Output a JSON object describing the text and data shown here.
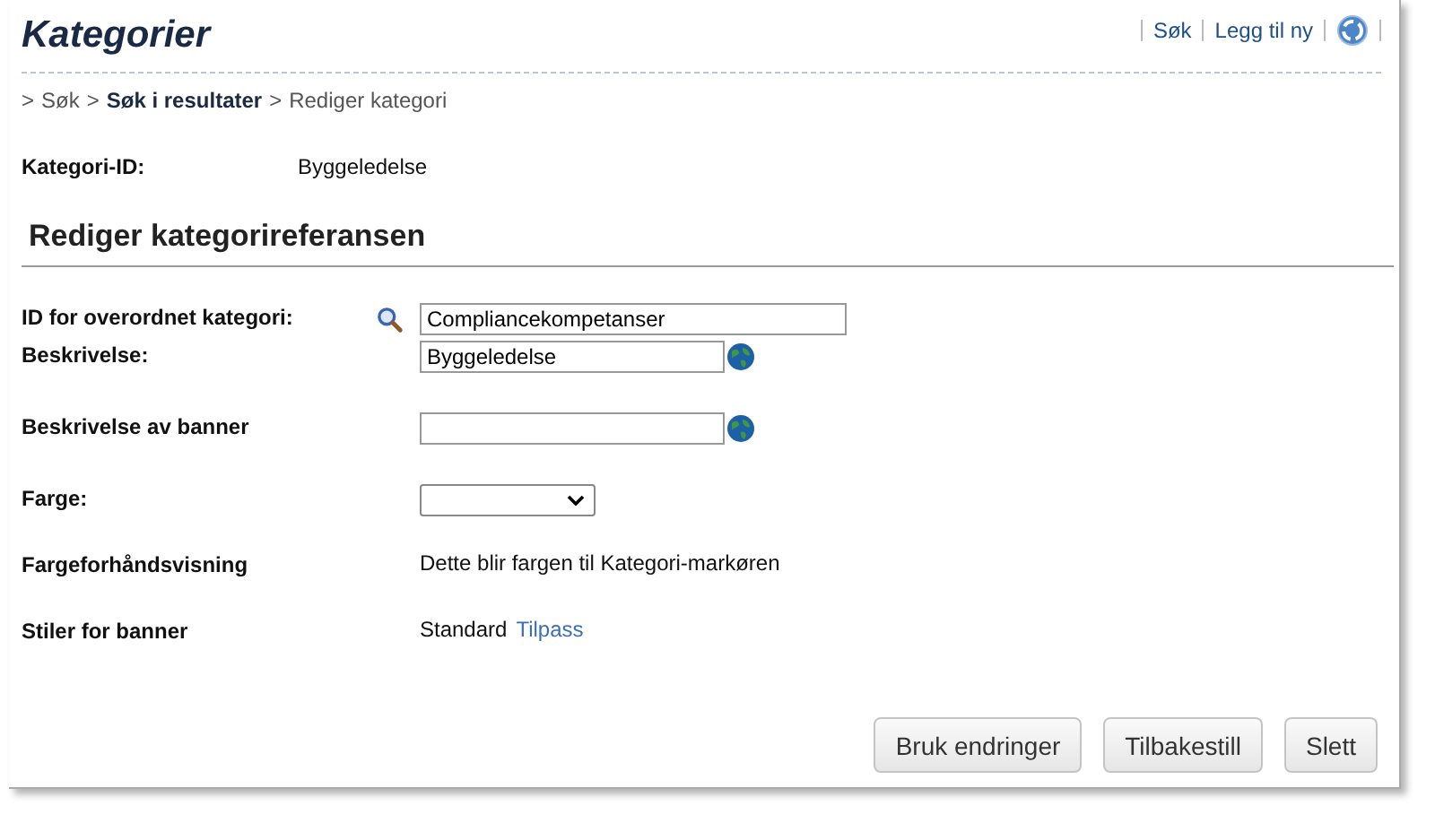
{
  "header": {
    "title": "Kategorier",
    "links": [
      {
        "label": "Søk"
      },
      {
        "label": "Legg til ny"
      }
    ]
  },
  "breadcrumb": [
    {
      "separator": ">",
      "label": "Søk",
      "kind": "plain"
    },
    {
      "separator": ">",
      "label": "Søk i resultater",
      "kind": "link"
    },
    {
      "separator": ">",
      "label": "Rediger kategori",
      "kind": "plain"
    }
  ],
  "summary": {
    "label": "Kategori-ID:",
    "value": "Byggeledelse"
  },
  "section": {
    "title": "Rediger kategorireferansen"
  },
  "fields": [
    {
      "kind": "lookup",
      "label": "ID for overordnet kategori:",
      "value": "Compliancekompetanser"
    },
    {
      "kind": "localized",
      "label": "Beskrivelse:",
      "value": "Byggeledelse"
    },
    {
      "kind": "localized",
      "label": "Beskrivelse av banner"
    },
    {
      "kind": "select",
      "label": "Farge:"
    },
    {
      "kind": "text",
      "label": "Fargeforhåndsvisning",
      "value": "Dette blir fargen til Kategori-markøren"
    },
    {
      "kind": "textlink",
      "label": "Stiler for banner",
      "value": "Standard",
      "link": "Tilpass"
    }
  ],
  "buttons": [
    {
      "label": "Bruk endringer"
    },
    {
      "label": "Tilbakestill"
    },
    {
      "label": "Slett"
    }
  ]
}
